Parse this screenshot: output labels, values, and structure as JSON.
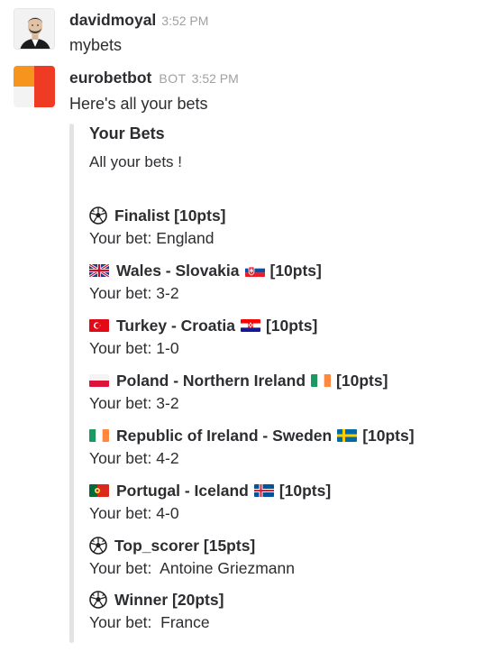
{
  "messages": [
    {
      "username": "davidmoyal",
      "time": "3:52 PM",
      "text": "mybets"
    },
    {
      "username": "eurobetbot",
      "badge": "BOT",
      "time": "3:52 PM",
      "text": "Here's all your bets"
    }
  ],
  "attachment": {
    "title": "Your Bets",
    "text": "All your bets !",
    "bets": [
      {
        "title": "Finalist",
        "points": "[10pts]",
        "bet_label": "Your bet:",
        "bet_value": "England",
        "icon_left": "soccer-ball-icon"
      },
      {
        "title": "Wales - Slovakia",
        "points": "[10pts]",
        "bet_label": "Your bet:",
        "bet_value": "3-2",
        "icon_left": "flag-uk-icon",
        "icon_right": "flag-slovakia-icon"
      },
      {
        "title": "Turkey - Croatia",
        "points": "[10pts]",
        "bet_label": "Your bet:",
        "bet_value": "1-0",
        "icon_left": "flag-turkey-icon",
        "icon_right": "flag-croatia-icon"
      },
      {
        "title": "Poland - Northern Ireland",
        "points": "[10pts]",
        "bet_label": "Your bet:",
        "bet_value": "3-2",
        "icon_left": "flag-poland-icon",
        "icon_right": "flag-ireland-icon"
      },
      {
        "title": "Republic of Ireland - Sweden",
        "points": "[10pts]",
        "bet_label": "Your bet:",
        "bet_value": "4-2",
        "icon_left": "flag-ireland-icon",
        "icon_right": "flag-sweden-icon"
      },
      {
        "title": "Portugal - Iceland",
        "points": "[10pts]",
        "bet_label": "Your bet:",
        "bet_value": "4-0",
        "icon_left": "flag-portugal-icon",
        "icon_right": "flag-iceland-icon"
      },
      {
        "title": "Top_scorer",
        "points": "[15pts]",
        "bet_label": "Your bet: ",
        "bet_value": "Antoine Griezmann",
        "icon_left": "soccer-ball-icon"
      },
      {
        "title": "Winner",
        "points": "[20pts]",
        "bet_label": "Your bet: ",
        "bet_value": "France",
        "icon_left": "soccer-ball-icon"
      }
    ]
  },
  "colors": {
    "text": "#2c2d30",
    "muted": "#a0a0a2",
    "attachment_bar": "#e3e3e3",
    "bot_avatar_red": "#ef3b24",
    "bot_avatar_orange": "#f7941d"
  }
}
